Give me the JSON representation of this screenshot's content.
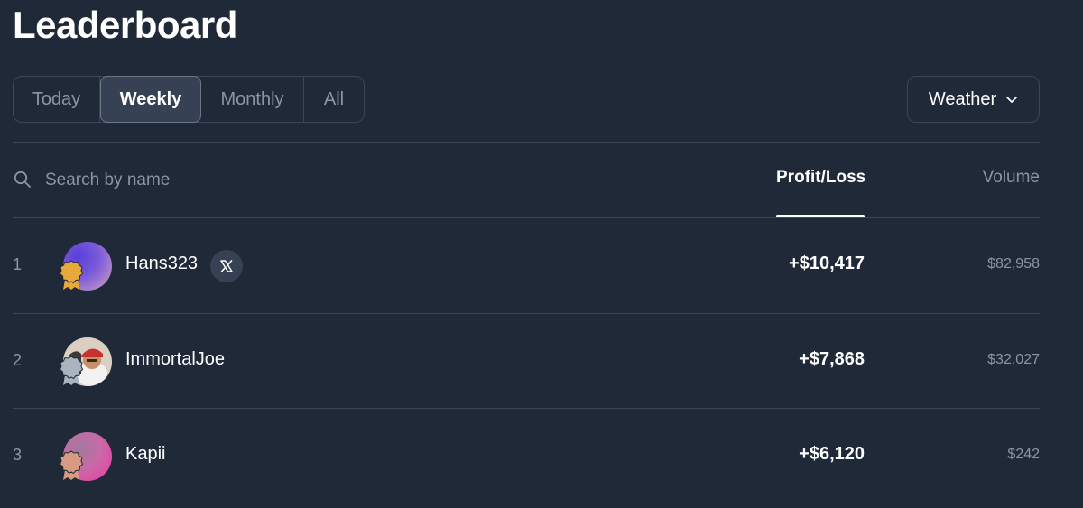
{
  "page": {
    "title": "Leaderboard"
  },
  "tabs": [
    {
      "label": "Today",
      "active": false
    },
    {
      "label": "Weekly",
      "active": true
    },
    {
      "label": "Monthly",
      "active": false
    },
    {
      "label": "All",
      "active": false
    }
  ],
  "category_dropdown": {
    "label": "Weather",
    "icon": "chevron-down-icon"
  },
  "search": {
    "placeholder": "Search by name",
    "value": "",
    "icon": "search-icon"
  },
  "columns": {
    "profit_loss": "Profit/Loss",
    "volume": "Volume",
    "sorted_by": "profit_loss"
  },
  "rows": [
    {
      "rank": "1",
      "name": "Hans323",
      "profit_loss": "+$10,417",
      "volume": "$82,958",
      "medal": "gold",
      "medal_color": "#e6a93a",
      "has_x_link": true
    },
    {
      "rank": "2",
      "name": "ImmortalJoe",
      "profit_loss": "+$7,868",
      "volume": "$32,027",
      "medal": "silver",
      "medal_color": "#a9b4bf",
      "has_x_link": false
    },
    {
      "rank": "3",
      "name": "Kapii",
      "profit_loss": "+$6,120",
      "volume": "$242",
      "medal": "bronze",
      "medal_color": "#d89a80",
      "has_x_link": false
    }
  ],
  "colors": {
    "background": "#1f2937",
    "border": "#3b4656",
    "muted_text": "#8b95a5",
    "active_tab_bg": "#364253"
  }
}
